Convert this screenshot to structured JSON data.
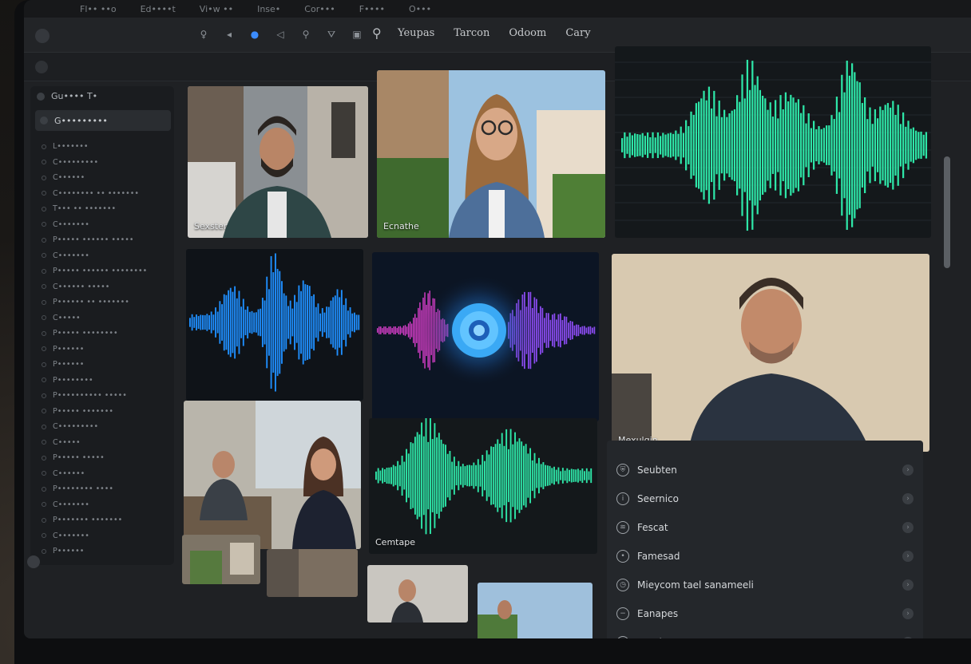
{
  "menubar": {
    "items": [
      "Fl•• ••o",
      "Ed••••t",
      "Vi•w ••",
      "Inse•",
      "Cor•••",
      "F••••",
      "O•••"
    ]
  },
  "toolbar": {
    "tabs": [
      "Yeupas",
      "Tarcon",
      "Odoom",
      "Cary"
    ]
  },
  "sidebar": {
    "header": "Gu•••• T•",
    "selected": "G•••••••••",
    "items": [
      "L•••••••",
      "C•••••••••",
      "C••••••",
      "C•••••••• •• •••••••",
      "T••• •• •••••••",
      "C•••••••",
      "P••••• •••••• •••••",
      "C•••••••",
      "P••••• •••••• ••••••••",
      "C•••••• •••••",
      "P•••••• •• •••••••",
      "C•••••",
      "P••••• ••••••••",
      "P••••••",
      "P••••••",
      "P••••••••",
      "P•••••••••• •••••",
      "P••••• •••••••",
      "C•••••••••",
      "C•••••",
      "P••••• •••••",
      "C••••••",
      "P•••••••• ••••",
      "C•••••••",
      "P••••••• •••••••",
      "C•••••••",
      "P••••••"
    ]
  },
  "tiles": {
    "t1_label": "Sexster",
    "t2_label": "Ecnathe",
    "t6_label": "Mexulgin",
    "t8_label": "Cemtape"
  },
  "panel": {
    "rows": [
      {
        "label": "Seubten",
        "icon": "shield-icon"
      },
      {
        "label": "Seernico",
        "icon": "info-icon"
      },
      {
        "label": "Fescat",
        "icon": "layers-icon"
      },
      {
        "label": "Famesad",
        "icon": "record-icon"
      },
      {
        "label": "Mieycom tael sanameeli",
        "icon": "clock-icon"
      },
      {
        "label": "Eanapes",
        "icon": "minus-icon"
      },
      {
        "label": "Foezlecton",
        "icon": "settings-icon"
      }
    ]
  },
  "colors": {
    "green_wave": "#2ee6a8",
    "blue_wave": "#1f8fff",
    "pink_wave": "#d63ec9",
    "purple_wave": "#8a4bf0",
    "orb": "#3bb4ff"
  }
}
